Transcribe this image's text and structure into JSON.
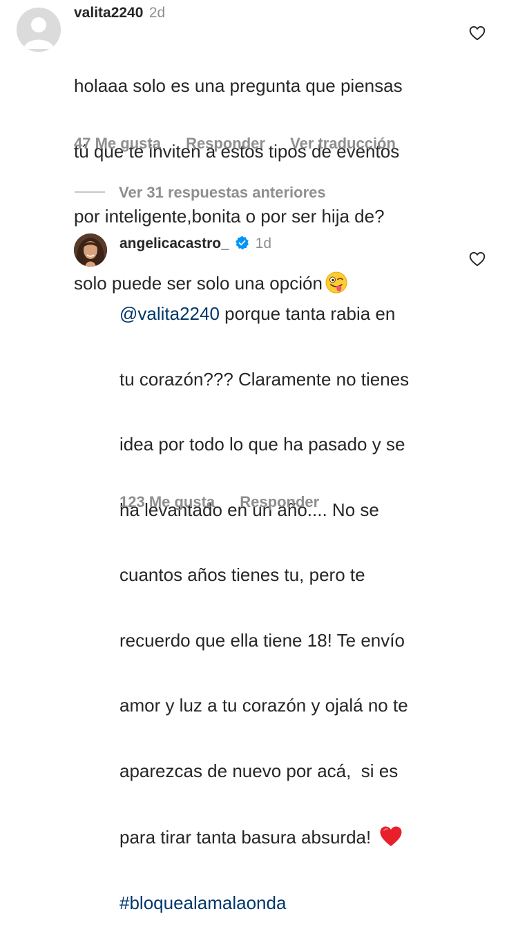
{
  "comment": {
    "username": "valita2240",
    "time": "2d",
    "lines": [
      "holaaa solo es una pregunta que piensas",
      "tú que te inviten a estos tipos de eventos",
      "por inteligente,bonita o por ser hija de?",
      "solo puede ser solo una opción"
    ],
    "emoji": "winking-face-with-tongue",
    "likes": "47 Me gusta",
    "reply": "Responder",
    "translate": "Ver traducción"
  },
  "view_replies": "Ver 31 respuestas anteriores",
  "reply": {
    "username": "angelicacastro_",
    "time": "1d",
    "mention": "@valita2240",
    "lines": [
      " porque tanta rabia en",
      "tu corazón??? Claramente no tienes",
      "idea por todo lo que ha pasado y se",
      "ha levantado en un año.... No se",
      "cuantos años tienes tu, pero te",
      "recuerdo que ella tiene 18! Te envío",
      "amor y luz a tu corazón y ojalá no te",
      "aparezcas de nuevo por acá,  si es",
      "para tirar tanta basura absurda!"
    ],
    "emoji": "red-heart",
    "hashtag": "#bloquealamalaonda",
    "likes": "123 Me gusta",
    "reply": "Responder"
  },
  "colors": {
    "text": "#262626",
    "secondary": "#8e8e8e",
    "link": "#00376b",
    "verified": "#0095f6"
  }
}
